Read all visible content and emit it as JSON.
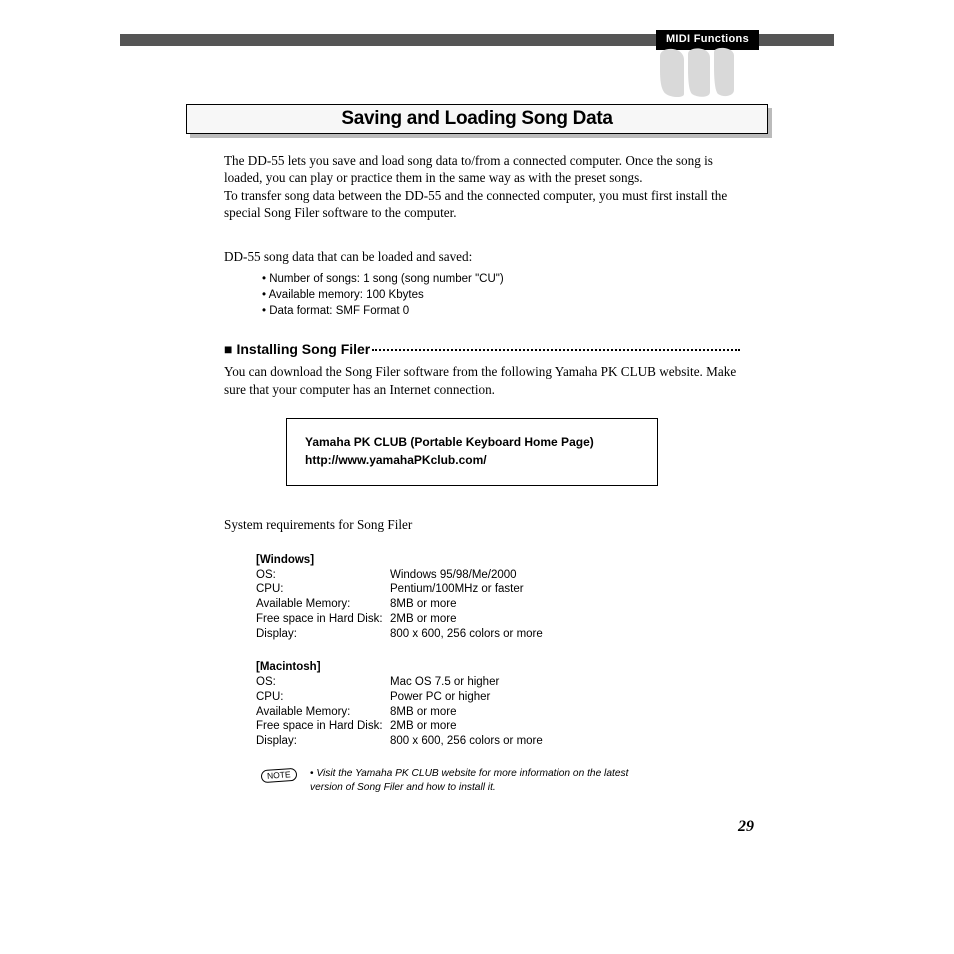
{
  "header": {
    "badge": "MIDI Functions"
  },
  "title": "Saving and Loading Song Data",
  "intro": {
    "p1": "The DD-55 lets you save and load song data to/from a connected computer.  Once the song is loaded, you can play or practice them in the same way as with the preset songs.",
    "p2": "To transfer song data between the DD-55 and the connected computer, you must first install the special Song Filer software to the computer.",
    "p3": "DD-55 song data that can be loaded and saved:"
  },
  "song_data_bullets": [
    "Number of songs: 1 song (song number \"CU\")",
    "Available memory: 100 Kbytes",
    "Data format: SMF Format 0"
  ],
  "section": {
    "heading": "Installing Song Filer",
    "p": "You can download the Song Filer software from the following Yamaha PK CLUB website.  Make sure that your computer has an Internet connection."
  },
  "infobox": {
    "line1": "Yamaha PK CLUB (Portable Keyboard Home Page)",
    "line2": "http://www.yamahaPKclub.com/"
  },
  "sysreq_title": "System requirements for Song Filer",
  "req": {
    "win": {
      "name": "Windows",
      "rows": [
        {
          "k": "OS:",
          "v": "Windows 95/98/Me/2000"
        },
        {
          "k": "CPU:",
          "v": "Pentium/100MHz or faster"
        },
        {
          "k": "Available Memory:",
          "v": "8MB or more"
        },
        {
          "k": "Free space in Hard Disk:",
          "v": "2MB or more"
        },
        {
          "k": "Display:",
          "v": "800 x 600, 256 colors or more"
        }
      ]
    },
    "mac": {
      "name": "Macintosh",
      "rows": [
        {
          "k": "OS:",
          "v": "Mac OS 7.5 or higher"
        },
        {
          "k": "CPU:",
          "v": "Power PC or higher"
        },
        {
          "k": "Available Memory:",
          "v": "8MB or more"
        },
        {
          "k": "Free space in Hard Disk:",
          "v": "2MB or more"
        },
        {
          "k": "Display:",
          "v": "800 x 600, 256 colors or more"
        }
      ]
    }
  },
  "note": {
    "label": "NOTE",
    "text": "Visit the Yamaha PK CLUB website for more information on the latest version of Song Filer and how to install it."
  },
  "page_number": "29"
}
